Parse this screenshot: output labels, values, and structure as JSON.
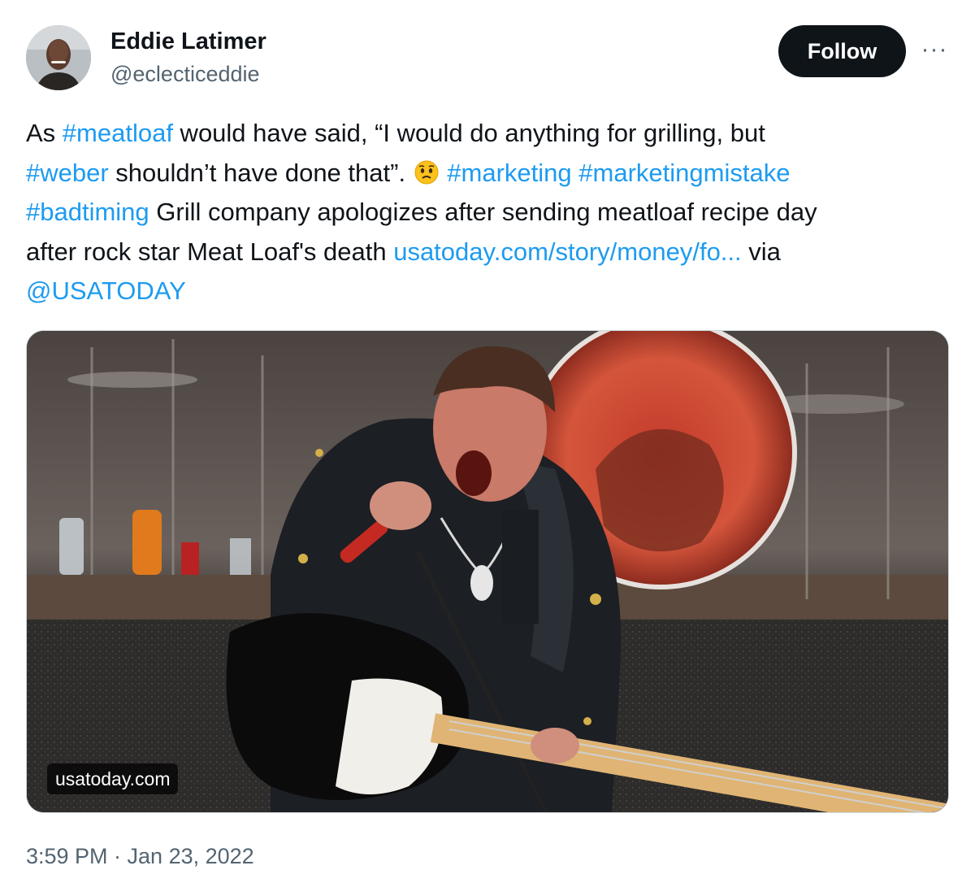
{
  "author": {
    "display_name": "Eddie Latimer",
    "handle": "@eclecticeddie",
    "avatar_icon": "user-avatar"
  },
  "actions": {
    "follow_label": "Follow",
    "more_label": "···"
  },
  "tweet": {
    "lines": [
      [
        {
          "t": "As ",
          "link": false
        },
        {
          "t": "#meatloaf",
          "link": true
        },
        {
          "t": " would have said, “I would do anything for grilling, but",
          "link": false
        }
      ],
      [
        {
          "t": "#weber",
          "link": true
        },
        {
          "t": " shouldn’t have done that”. ",
          "link": false
        },
        {
          "emoji": "worried-face"
        },
        {
          "t": " ",
          "link": false
        },
        {
          "t": "#marketing",
          "link": true
        },
        {
          "t": " ",
          "link": false
        },
        {
          "t": "#marketingmistake",
          "link": true
        }
      ],
      [
        {
          "t": "#badtiming",
          "link": true
        },
        {
          "t": " Grill company apologizes after sending meatloaf recipe day",
          "link": false
        }
      ],
      [
        {
          "t": "after rock star Meat Loaf's death ",
          "link": false
        },
        {
          "t": "usatoday.com/story/money/fo...",
          "link": true
        },
        {
          "t": " via",
          "link": false
        }
      ],
      [
        {
          "t": "@USATODAY",
          "link": true
        }
      ]
    ]
  },
  "media": {
    "source_label": "usatoday.com",
    "description_icon": "concert-photo"
  },
  "meta": {
    "timestamp": "3:59 PM · Jan 23, 2022"
  },
  "colors": {
    "link": "#1d9bf0",
    "text": "#0f1419",
    "secondary": "#536471",
    "follow_bg": "#0f1419"
  }
}
